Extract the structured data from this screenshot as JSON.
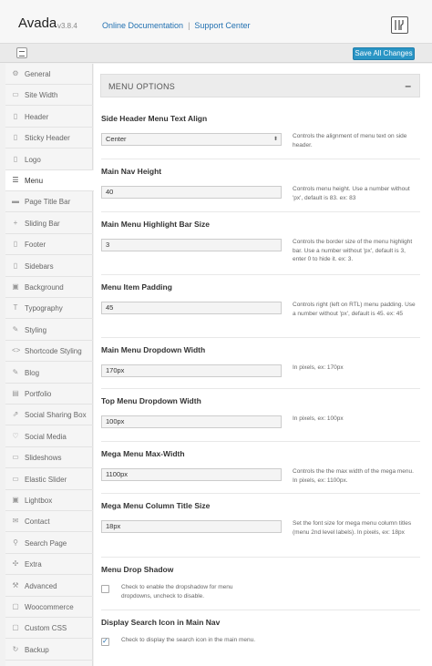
{
  "header": {
    "brand": "Avada",
    "version": "v3.8.4",
    "link_docs": "Online Documentation",
    "separator": "|",
    "link_support": "Support Center"
  },
  "toolbar": {
    "save_label": "Save All Changes"
  },
  "sidebar": {
    "items": [
      {
        "label": "General",
        "icon": "gear-icon",
        "glyph": "⚙"
      },
      {
        "label": "Site Width",
        "icon": "resize-icon",
        "glyph": "▭"
      },
      {
        "label": "Header",
        "icon": "header-icon",
        "glyph": "▯"
      },
      {
        "label": "Sticky Header",
        "icon": "pin-icon",
        "glyph": "▯"
      },
      {
        "label": "Logo",
        "icon": "image-icon",
        "glyph": "▯"
      },
      {
        "label": "Menu",
        "icon": "menu-icon",
        "glyph": "☰"
      },
      {
        "label": "Page Title Bar",
        "icon": "title-bar-icon",
        "glyph": "▬"
      },
      {
        "label": "Sliding Bar",
        "icon": "plus-icon",
        "glyph": "+"
      },
      {
        "label": "Footer",
        "icon": "footer-icon",
        "glyph": "▯"
      },
      {
        "label": "Sidebars",
        "icon": "columns-icon",
        "glyph": "▯"
      },
      {
        "label": "Background",
        "icon": "picture-icon",
        "glyph": "▣"
      },
      {
        "label": "Typography",
        "icon": "text-icon",
        "glyph": "T"
      },
      {
        "label": "Styling",
        "icon": "brush-icon",
        "glyph": "✎"
      },
      {
        "label": "Shortcode Styling",
        "icon": "code-icon",
        "glyph": "<>"
      },
      {
        "label": "Blog",
        "icon": "pencil-icon",
        "glyph": "✎"
      },
      {
        "label": "Portfolio",
        "icon": "briefcase-icon",
        "glyph": "▤"
      },
      {
        "label": "Social Sharing Box",
        "icon": "share-icon",
        "glyph": "⇗"
      },
      {
        "label": "Social Media",
        "icon": "heart-icon",
        "glyph": "♡"
      },
      {
        "label": "Slideshows",
        "icon": "slides-icon",
        "glyph": "▭"
      },
      {
        "label": "Elastic Slider",
        "icon": "slider-icon",
        "glyph": "▭"
      },
      {
        "label": "Lightbox",
        "icon": "lightbox-icon",
        "glyph": "▣"
      },
      {
        "label": "Contact",
        "icon": "mail-icon",
        "glyph": "✉"
      },
      {
        "label": "Search Page",
        "icon": "search-icon",
        "glyph": "⚲"
      },
      {
        "label": "Extra",
        "icon": "puzzle-icon",
        "glyph": "✣"
      },
      {
        "label": "Advanced",
        "icon": "wrench-icon",
        "glyph": "⚒"
      },
      {
        "label": "Woocommerce",
        "icon": "cart-icon",
        "glyph": "▢"
      },
      {
        "label": "Custom CSS",
        "icon": "css-icon",
        "glyph": "▢"
      },
      {
        "label": "Backup",
        "icon": "refresh-icon",
        "glyph": "↻"
      }
    ],
    "active_index": 5
  },
  "section": {
    "title": "MENU OPTIONS",
    "toggle": "–"
  },
  "options": [
    {
      "title": "Side Header Menu Text Align",
      "type": "select",
      "value": "Center",
      "desc": "Controls the alignment of menu text on side header."
    },
    {
      "title": "Main Nav Height",
      "type": "text",
      "value": "40",
      "desc": "Controls menu height. Use a number without 'px', default is 83. ex: 83"
    },
    {
      "title": "Main Menu Highlight Bar Size",
      "type": "text",
      "value": "3",
      "desc": "Controls the border size of the menu highlight bar. Use a number without 'px', default is 3, enter 0 to hide it. ex: 3."
    },
    {
      "title": "Menu Item Padding",
      "type": "text",
      "value": "45",
      "desc": "Controls right (left on RTL) menu padding. Use a number without 'px', default is 45. ex: 45"
    },
    {
      "title": "Main Menu Dropdown Width",
      "type": "text",
      "value": "170px",
      "desc": "In pixels, ex: 170px"
    },
    {
      "title": "Top Menu Dropdown Width",
      "type": "text",
      "value": "100px",
      "desc": "In pixels, ex: 100px"
    },
    {
      "title": "Mega Menu Max-Width",
      "type": "text",
      "value": "1100px",
      "desc": "Controls the the max width of the mega menu. In pixels, ex: 1100px."
    },
    {
      "title": "Mega Menu Column Title Size",
      "type": "text",
      "value": "18px",
      "desc": "Set the font size for mega menu column titles (menu 2nd level labels). In pixels, ex: 18px"
    },
    {
      "title": "Menu Drop Shadow",
      "type": "checkbox",
      "checked": false,
      "desc": "Check to enable the dropshadow for menu dropdowns, uncheck to disable."
    },
    {
      "title": "Display Search Icon in Main Nav",
      "type": "checkbox",
      "checked": true,
      "desc": "Check to display the search icon in the main menu."
    }
  ]
}
